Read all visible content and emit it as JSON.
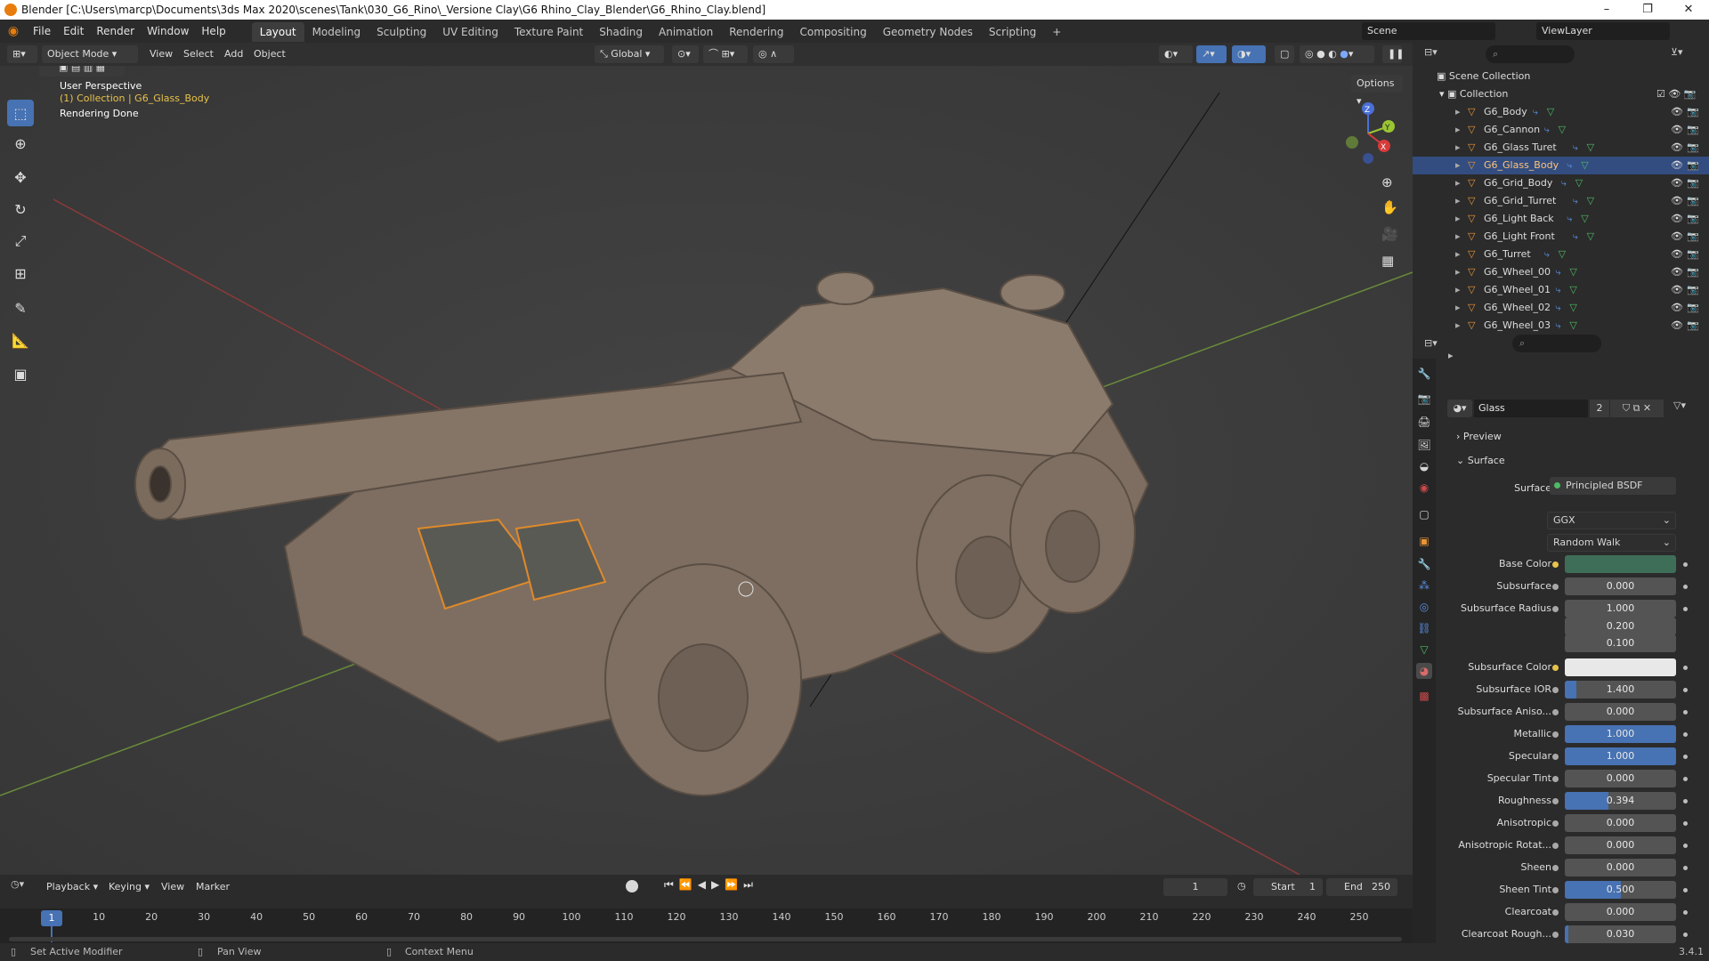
{
  "window": {
    "title": "Blender [C:\\Users\\marcp\\Documents\\3ds Max 2020\\scenes\\Tank\\030_G6_Rino\\_Versione Clay\\G6 Rhino_Clay_Blender\\G6_Rhino_Clay.blend]"
  },
  "menu": [
    "File",
    "Edit",
    "Render",
    "Window",
    "Help"
  ],
  "workspaces": [
    "Layout",
    "Modeling",
    "Sculpting",
    "UV Editing",
    "Texture Paint",
    "Shading",
    "Animation",
    "Rendering",
    "Compositing",
    "Geometry Nodes",
    "Scripting"
  ],
  "active_workspace": "Layout",
  "scene": {
    "label": "Scene",
    "viewlayer": "ViewLayer"
  },
  "viewport_header": {
    "mode": "Object Mode",
    "view": "View",
    "select": "Select",
    "add": "Add",
    "object": "Object",
    "orientation": "Global",
    "options": "Options"
  },
  "viewport": {
    "line1": "User Perspective",
    "line2": "(1) Collection | G6_Glass_Body",
    "line3": "Rendering Done"
  },
  "outliner": {
    "root": "Scene Collection",
    "collection": "Collection",
    "items": [
      "G6_Body",
      "G6_Cannon",
      "G6_Glass Turet",
      "G6_Glass_Body",
      "G6_Grid_Body",
      "G6_Grid_Turret",
      "G6_Light Back",
      "G6_Light Front",
      "G6_Turret",
      "G6_Wheel_00",
      "G6_Wheel_01",
      "G6_Wheel_02",
      "G6_Wheel_03"
    ],
    "selected": "G6_Glass_Body"
  },
  "material": {
    "name": "Glass",
    "users": "2"
  },
  "panels": {
    "preview": "Preview",
    "surface": "Surface"
  },
  "surface": {
    "label": "Surface",
    "shader": "Principled BSDF",
    "distribution": "GGX",
    "subsurface_method": "Random Walk"
  },
  "properties": [
    {
      "label": "Base Color",
      "value": "",
      "kind": "color",
      "color": "#3e6e58"
    },
    {
      "label": "Subsurface",
      "value": "0.000",
      "fill": 0
    },
    {
      "label": "Subsurface Radius",
      "value": "1.000",
      "fill": 0
    },
    {
      "label": "",
      "value": "0.200",
      "fill": 0
    },
    {
      "label": "",
      "value": "0.100",
      "fill": 0
    },
    {
      "label": "Subsurface Color",
      "value": "",
      "kind": "color",
      "color": "#e8e8e8"
    },
    {
      "label": "Subsurface IOR",
      "value": "1.400",
      "fill": 0.1
    },
    {
      "label": "Subsurface Aniso...",
      "value": "0.000",
      "fill": 0
    },
    {
      "label": "Metallic",
      "value": "1.000",
      "fill": 1
    },
    {
      "label": "Specular",
      "value": "1.000",
      "fill": 1
    },
    {
      "label": "Specular Tint",
      "value": "0.000",
      "fill": 0
    },
    {
      "label": "Roughness",
      "value": "0.394",
      "fill": 0.394
    },
    {
      "label": "Anisotropic",
      "value": "0.000",
      "fill": 0
    },
    {
      "label": "Anisotropic Rotat...",
      "value": "0.000",
      "fill": 0
    },
    {
      "label": "Sheen",
      "value": "0.000",
      "fill": 0
    },
    {
      "label": "Sheen Tint",
      "value": "0.500",
      "fill": 0.5
    },
    {
      "label": "Clearcoat",
      "value": "0.000",
      "fill": 0
    },
    {
      "label": "Clearcoat Rough...",
      "value": "0.030",
      "fill": 0.03
    }
  ],
  "timeline": {
    "playback": "Playback",
    "keying": "Keying",
    "view": "View",
    "marker": "Marker",
    "current_frame": "1",
    "start_label": "Start",
    "start": "1",
    "end_label": "End",
    "end": "250",
    "ticks": [
      "10",
      "20",
      "30",
      "40",
      "50",
      "60",
      "70",
      "80",
      "90",
      "100",
      "110",
      "120",
      "130",
      "140",
      "150",
      "160",
      "170",
      "180",
      "190",
      "200",
      "210",
      "220",
      "230",
      "240",
      "250"
    ]
  },
  "status": {
    "left": "Set Active Modifier",
    "mid": "Pan View",
    "right": "Context Menu",
    "version": "3.4.1"
  }
}
